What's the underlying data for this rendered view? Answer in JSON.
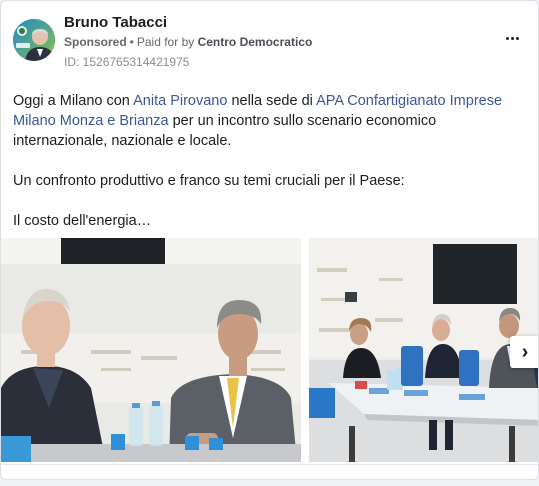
{
  "post": {
    "author": "Bruno Tabacci",
    "sponsored_label": "Sponsored",
    "separator": "•",
    "paid_for_prefix": "Paid for by",
    "paid_for_by": "Centro Democratico",
    "ad_id": "ID: 1526765314421975",
    "avatar_logo_text": "CD TABACCI",
    "icons": {
      "more": "more-options-icon",
      "next": "chevron-right-icon"
    },
    "body": {
      "p1_part1": "Oggi a Milano con ",
      "p1_link1": "Anita Pirovano",
      "p1_part2": " nella sede di ",
      "p1_link2": "APA Confartigianato Imprese Milano Monza e Brianza",
      "p1_part3": " per un incontro sullo scenario economico internazionale, nazionale e locale.",
      "p2": "Un confronto produttivo e franco su temi cruciali per il Paese:",
      "p3": "Il costo dell'energia…"
    },
    "colors": {
      "link": "#385898",
      "text": "#1c1e21",
      "muted": "#65676b",
      "background": "#f0f2f5"
    }
  }
}
